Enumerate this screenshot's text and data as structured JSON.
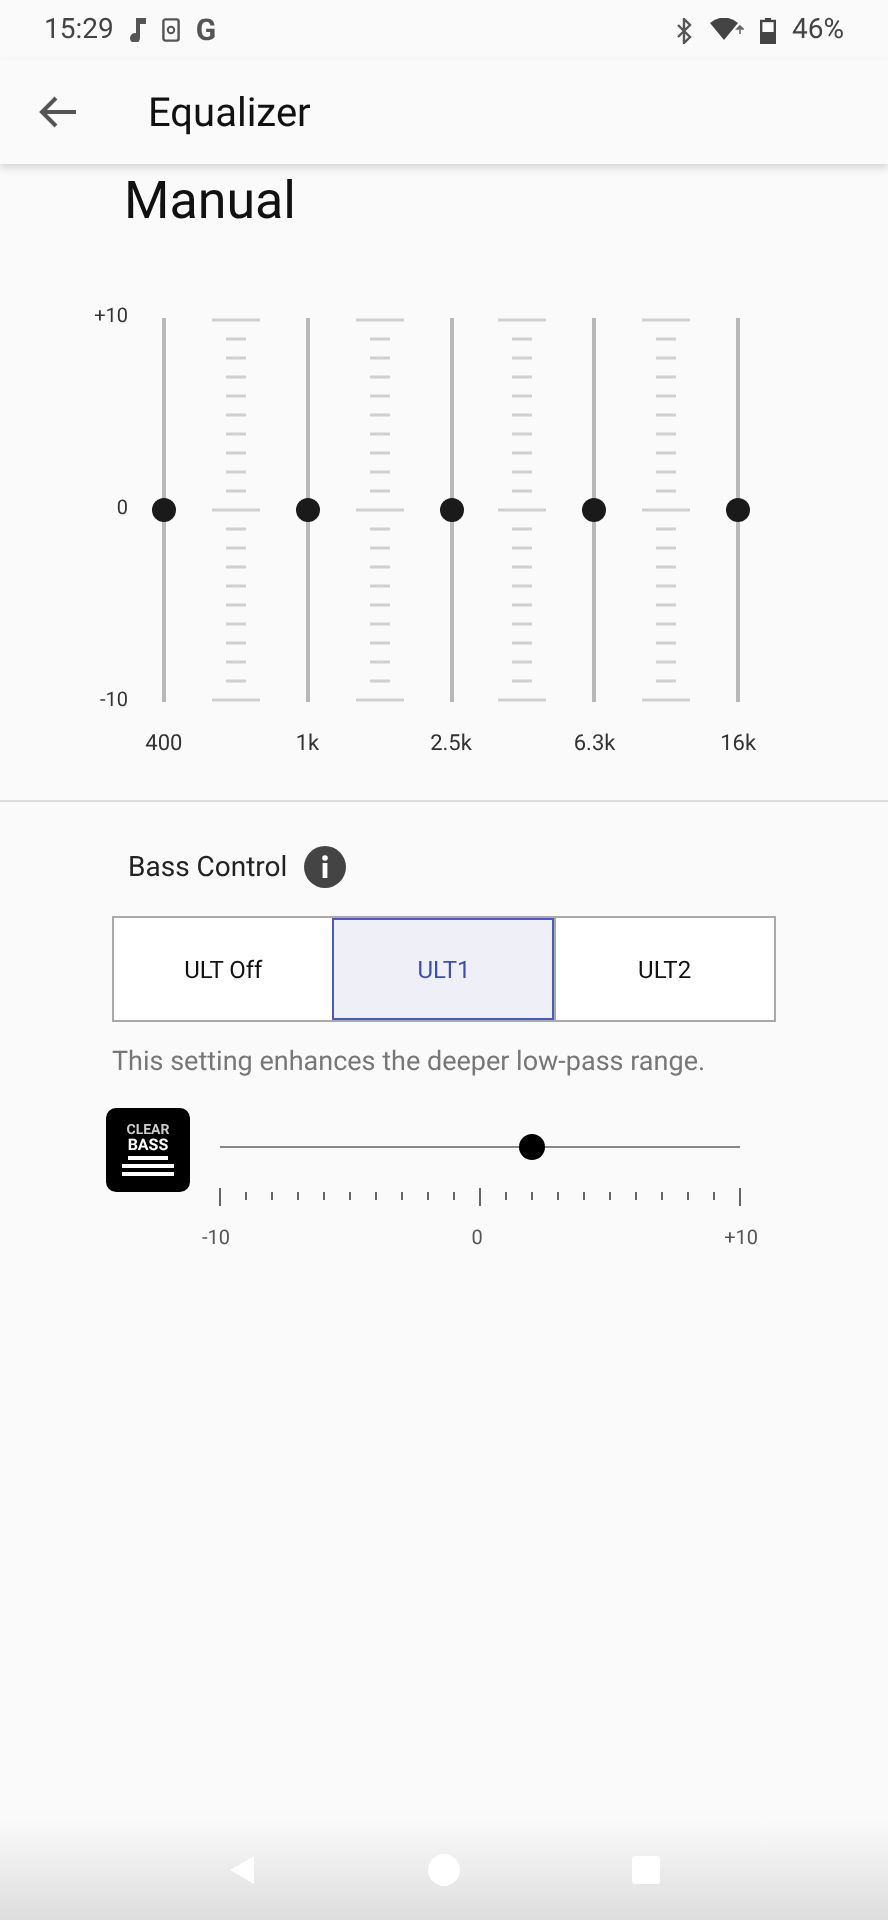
{
  "status_bar": {
    "time": "15:29",
    "notification_letter": "G",
    "battery": "46%"
  },
  "app_bar": {
    "title": "Equalizer"
  },
  "preset": "Manual",
  "equalizer": {
    "scale": [
      "+10",
      "0",
      "-10"
    ],
    "bands": [
      {
        "label": "400",
        "level": 0.5
      },
      {
        "label": "1k",
        "level": 0.5
      },
      {
        "label": "2.5k",
        "level": 0.5
      },
      {
        "label": "6.3k",
        "level": 0.5
      },
      {
        "label": "16k",
        "level": 0.5
      }
    ]
  },
  "bass_control": {
    "title": "Bass Control",
    "options": [
      {
        "label": "ULT Off",
        "selected": false
      },
      {
        "label": "ULT1",
        "selected": true
      },
      {
        "label": "ULT2",
        "selected": false
      }
    ],
    "description": "This setting enhances the deeper low-pass range.",
    "clear_bass": {
      "logo_text": [
        "CLEAR",
        "BASS"
      ],
      "level": 0.6,
      "scale": [
        "-10",
        "0",
        "+10"
      ]
    }
  }
}
